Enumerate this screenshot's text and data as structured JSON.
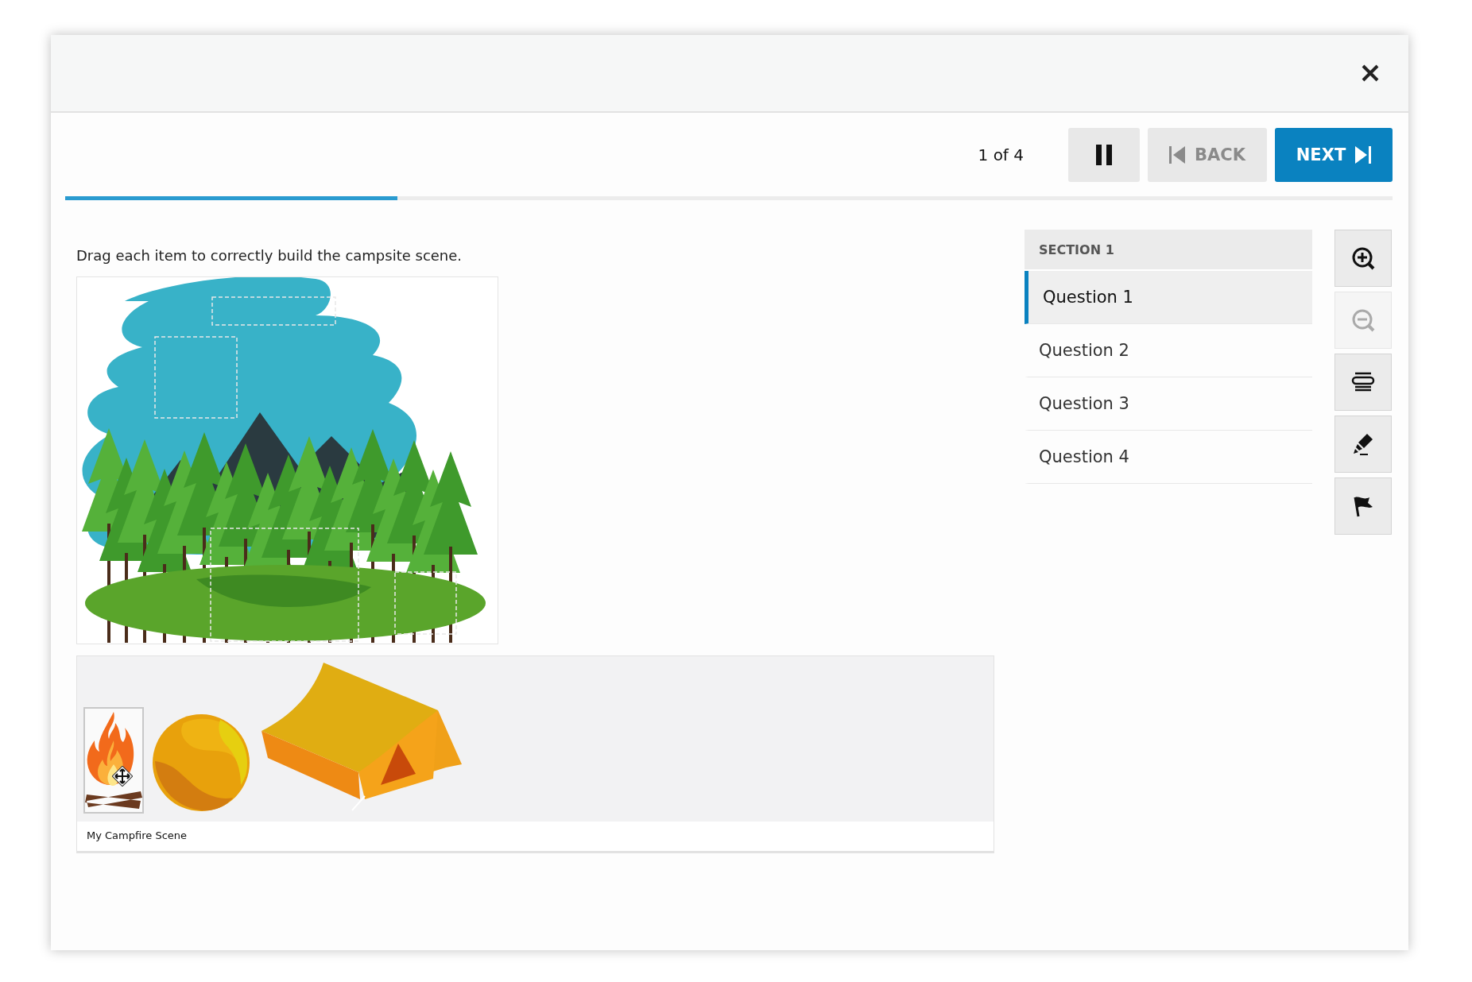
{
  "toolbar": {
    "position": "1 of 4",
    "back": {
      "label": "BACK",
      "disabled": true
    },
    "next": {
      "label": "NEXT",
      "disabled": false
    }
  },
  "progress": {
    "level": 0.25
  },
  "question": {
    "prompt": "Drag each item to correctly build the campsite scene."
  },
  "tray": {
    "items": [
      {
        "kind": "campfire",
        "selected": true
      },
      {
        "kind": "sun",
        "selected": false
      },
      {
        "kind": "tent",
        "selected": false
      }
    ],
    "caption": "My Campfire Scene"
  },
  "navigator": {
    "section": "SECTION 1",
    "questions": [
      {
        "label": "Question 1",
        "selected": true
      },
      {
        "label": "Question 2",
        "selected": false
      },
      {
        "label": "Question 3",
        "selected": false
      },
      {
        "label": "Question 4",
        "selected": false
      }
    ]
  },
  "tools": [
    {
      "kind": "zoom_in",
      "disabled": false
    },
    {
      "kind": "zoom_out",
      "disabled": true
    },
    {
      "kind": "line_reader",
      "disabled": false
    },
    {
      "kind": "highlighter",
      "disabled": false
    },
    {
      "kind": "flag",
      "disabled": false
    }
  ]
}
